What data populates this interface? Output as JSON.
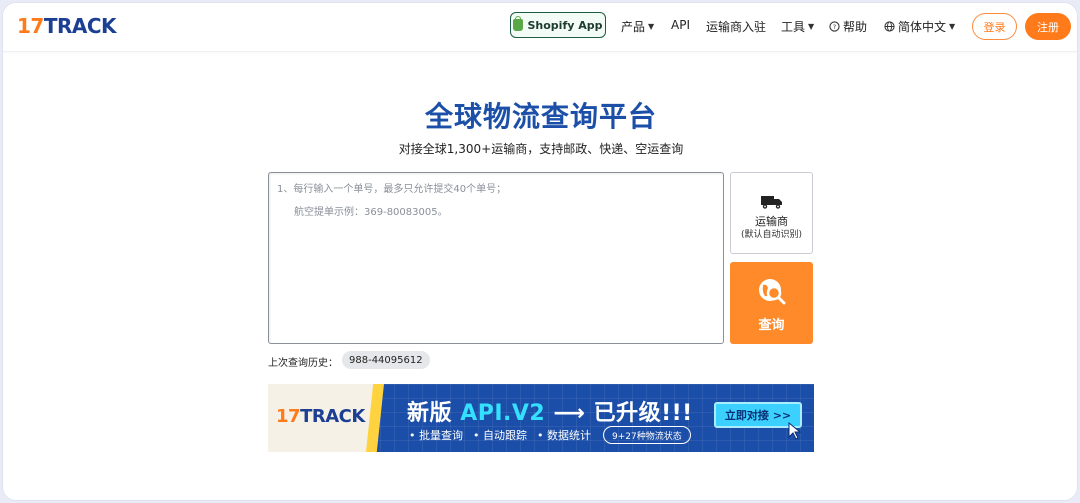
{
  "header": {
    "logo_num": "17",
    "logo_text": "TRACK",
    "shopify_label": "Shopify App",
    "nav": {
      "products": "产品",
      "api": "API",
      "carriers": "运输商入驻",
      "tools": "工具",
      "help": "帮助",
      "language": "简体中文"
    },
    "login": "登录",
    "register": "注册"
  },
  "hero": {
    "title": "全球物流查询平台",
    "subtitle": "对接全球1,300+运输商，支持邮政、快递、空运查询"
  },
  "search": {
    "placeholder_line1": "1、每行输入一个单号，最多只允许提交40个单号；",
    "placeholder_line2": "航空提单示例：369-80083005。",
    "carrier_label": "运输商",
    "carrier_sub": "(默认自动识别)",
    "query_label": "查询"
  },
  "history": {
    "label": "上次查询历史：",
    "items": [
      "988-44095612"
    ]
  },
  "banner": {
    "logo_num": "17",
    "logo_text": "TRACK",
    "head_prefix": "新版",
    "head_api": "API.V2",
    "head_suffix": "已升级!!!",
    "features": [
      "• 批量查询",
      "• 自动跟踪",
      "• 数据统计"
    ],
    "tag": "9+27种物流状态",
    "cta": "立即对接 >>"
  },
  "colors": {
    "brand_blue": "#1c4fa8",
    "accent_orange": "#ff7a1a"
  }
}
